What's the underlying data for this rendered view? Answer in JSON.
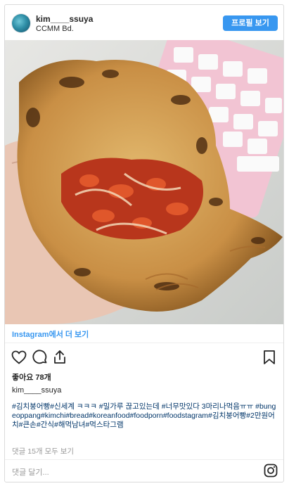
{
  "header": {
    "username": "kim____ssuya",
    "location": "CCMM Bd.",
    "profile_button": "프로필 보기"
  },
  "photo": {
    "description_icon": "food-photo"
  },
  "more_link": "Instagram에서 더 보기",
  "actions": {
    "like_icon": "heart-icon",
    "comment_icon": "comment-icon",
    "share_icon": "share-icon",
    "save_icon": "bookmark-icon"
  },
  "likes": "좋아요 78개",
  "caption": {
    "author": "kim____ssuya",
    "text": "#김치붕어빵#신세계 ㅋㅋㅋ #밀가루 끊고있는데 #너무맛있다 3마리나먹음ㅠㅠ #bungeoppang#kimchi#bread#koreanfood#foodporn#foodstagram#김치붕어빵#2만원어치#큰손#간식#해먹남녀#먹스타그램"
  },
  "comments_link": "댓글 15개 모두 보기",
  "comment_input_placeholder": "댓글 달기...",
  "colors": {
    "accent": "#3897f0",
    "hashtag": "#003569"
  }
}
